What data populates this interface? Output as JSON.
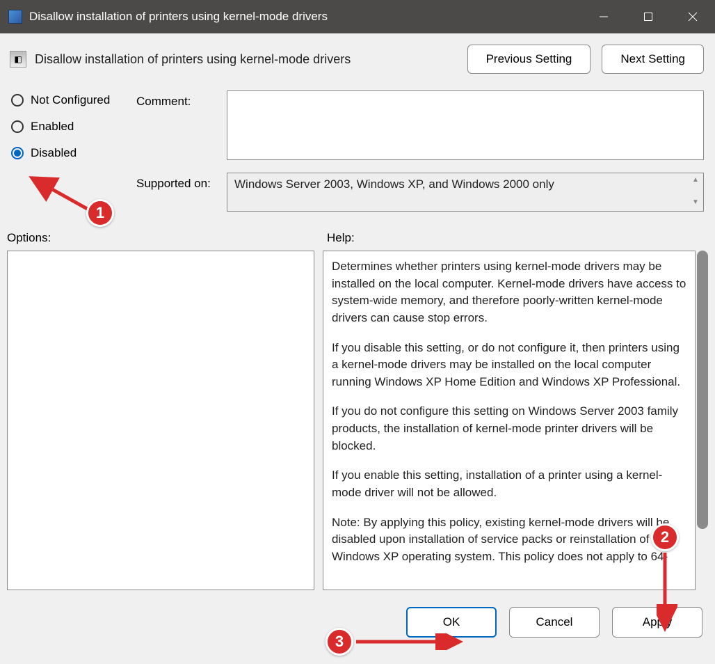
{
  "titlebar": {
    "title": "Disallow installation of printers using kernel-mode drivers"
  },
  "header": {
    "policy_name": "Disallow installation of printers using kernel-mode drivers",
    "prev_btn": "Previous Setting",
    "next_btn": "Next Setting"
  },
  "radios": {
    "not_configured": "Not Configured",
    "enabled": "Enabled",
    "disabled": "Disabled",
    "selected": "disabled"
  },
  "fields": {
    "comment_label": "Comment:",
    "comment_value": "",
    "supported_label": "Supported on:",
    "supported_value": "Windows Server 2003, Windows XP, and Windows 2000 only"
  },
  "labels": {
    "options": "Options:",
    "help": "Help:"
  },
  "help_paragraphs": [
    "Determines whether printers using kernel-mode drivers may be installed on the local computer.  Kernel-mode drivers have access to system-wide memory, and therefore poorly-written kernel-mode drivers can cause stop errors.",
    "If you disable this setting, or do not configure it, then printers using a kernel-mode drivers may be installed on the local computer running Windows XP Home Edition and Windows XP Professional.",
    "If you do not configure this setting on Windows Server 2003 family products, the installation of kernel-mode printer drivers will be blocked.",
    "If you enable this setting, installation of a printer using a kernel-mode driver will not be allowed.",
    "Note: By applying this policy, existing kernel-mode drivers will be disabled upon installation of service packs or reinstallation of the Windows XP operating system. This policy does not apply to 64-"
  ],
  "buttons": {
    "ok": "OK",
    "cancel": "Cancel",
    "apply": "Apply"
  },
  "annotations": {
    "b1": "1",
    "b2": "2",
    "b3": "3"
  }
}
